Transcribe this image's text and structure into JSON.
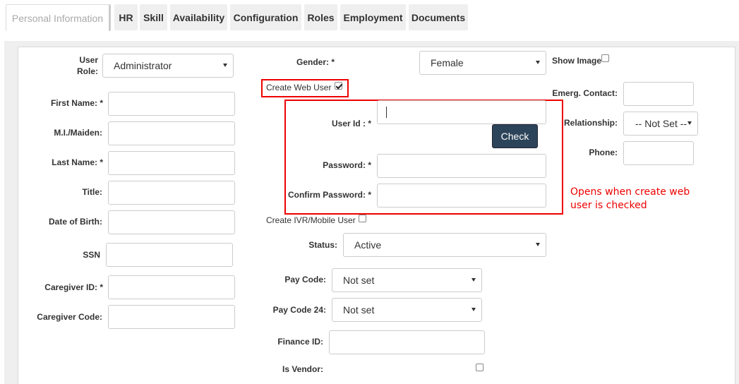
{
  "tabs": [
    {
      "label": "Personal Information",
      "active": true
    },
    {
      "label": "HR"
    },
    {
      "label": "Skill"
    },
    {
      "label": "Availability"
    },
    {
      "label": "Configuration"
    },
    {
      "label": "Roles"
    },
    {
      "label": "Employment"
    },
    {
      "label": "Documents"
    }
  ],
  "left_column": {
    "user_role_label": "User Role:",
    "user_role_value": "Administrator",
    "first_name_label": "First Name: *",
    "mi_label": "M.I./Maiden:",
    "last_name_label": "Last Name: *",
    "title_label": "Title:",
    "dob_label": "Date of Birth:",
    "ssn_label": "SSN",
    "caregiver_id_label": "Caregiver ID: *",
    "caregiver_code_label": "Caregiver Code:"
  },
  "middle_column": {
    "gender_label": "Gender: *",
    "gender_value": "Female",
    "create_web_user_label": "Create Web User",
    "create_web_user_checked": true,
    "user_id_label": "User Id : *",
    "user_id_value": "",
    "check_button": "Check",
    "password_label": "Password: *",
    "confirm_password_label": "Confirm Password: *",
    "create_ivr_label": "Create IVR/Mobile User",
    "status_label": "Status:",
    "status_value": "Active",
    "pay_code_label": "Pay Code:",
    "pay_code_value": "Not set",
    "pay_code_24_label": "Pay Code 24:",
    "pay_code_24_value": "Not set",
    "finance_id_label": "Finance ID:",
    "is_vendor_label": "Is Vendor:"
  },
  "right_column": {
    "show_image_label": "Show Image",
    "emerg_contact_label": "Emerg. Contact:",
    "relationship_label": "Relationship:",
    "relationship_value": "-- Not Set --",
    "phone_label": "Phone:"
  },
  "annotation": {
    "line1": "Opens when create web",
    "line2": "user is checked",
    "color": "#e00000"
  }
}
